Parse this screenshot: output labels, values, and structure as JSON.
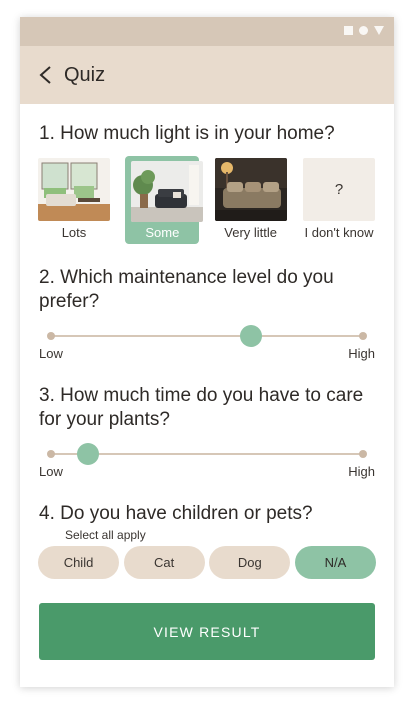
{
  "colors": {
    "statusbar": "#d6c7b7",
    "appbar": "#e8dbcd",
    "accent": "#8ec3a5",
    "primary_button": "#4a9a6a",
    "chip": "#e8dbcd"
  },
  "statusbar": {
    "icons": [
      "square-icon",
      "circle-icon",
      "triangle-icon"
    ]
  },
  "appbar": {
    "back_icon": "chevron-left-icon",
    "title": "Quiz"
  },
  "q1": {
    "title": "1. How much light is in your home?",
    "options": [
      {
        "label": "Lots",
        "selected": false
      },
      {
        "label": "Some",
        "selected": true
      },
      {
        "label": "Very little",
        "selected": false
      },
      {
        "label": "I don't know",
        "selected": false,
        "symbol": "?"
      }
    ]
  },
  "q2": {
    "title": "2. Which maintenance level do you prefer?",
    "slider": {
      "min_label": "Low",
      "max_label": "High",
      "value": 0.64
    }
  },
  "q3": {
    "title": "3. How much time do you have to care for your plants?",
    "slider": {
      "min_label": "Low",
      "max_label": "High",
      "value": 0.12
    }
  },
  "q4": {
    "title": "4. Do you have children or pets?",
    "subtitle": "Select all apply",
    "chips": [
      {
        "label": "Child",
        "selected": false
      },
      {
        "label": "Cat",
        "selected": false
      },
      {
        "label": "Dog",
        "selected": false
      },
      {
        "label": "N/A",
        "selected": true
      }
    ]
  },
  "cta": {
    "label": "VIEW RESULT"
  }
}
